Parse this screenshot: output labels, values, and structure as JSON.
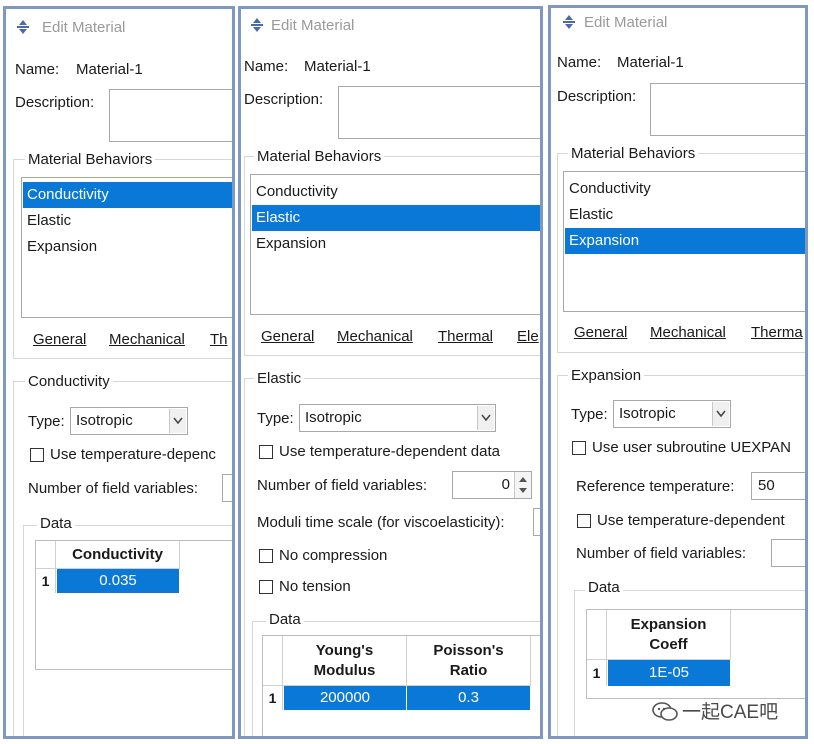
{
  "panels": [
    {
      "window_title": "Edit Material",
      "name_label": "Name:",
      "name_value": "Material-1",
      "description_label": "Description:",
      "behaviors_title": "Material Behaviors",
      "behaviors": [
        "Conductivity",
        "Elastic",
        "Expansion"
      ],
      "selected_behavior": "Conductivity",
      "tabs": [
        "General",
        "Mechanical",
        "Th"
      ],
      "section_title": "Conductivity",
      "type_label": "Type:",
      "type_value": "Isotropic",
      "checkbox_1": "Use temperature-depenc",
      "field_vars_label": "Number of field variables:",
      "data_title": "Data",
      "columns": [
        "Conductivity"
      ],
      "row_number": "1",
      "row_values": [
        "0.035"
      ]
    },
    {
      "window_title": "Edit Material",
      "name_label": "Name:",
      "name_value": "Material-1",
      "description_label": "Description:",
      "behaviors_title": "Material Behaviors",
      "behaviors": [
        "Conductivity",
        "Elastic",
        "Expansion"
      ],
      "selected_behavior": "Elastic",
      "tabs": [
        "General",
        "Mechanical",
        "Thermal",
        "Ele"
      ],
      "section_title": "Elastic",
      "type_label": "Type:",
      "type_value": "Isotropic",
      "checkbox_1": "Use temperature-dependent data",
      "field_vars_label": "Number of field variables:",
      "field_vars_value": "0",
      "moduli_label": "Moduli time scale (for viscoelasticity):",
      "checkbox_2": "No compression",
      "checkbox_3": "No tension",
      "data_title": "Data",
      "columns": [
        "Young's Modulus",
        "Poisson's Ratio"
      ],
      "row_number": "1",
      "row_values": [
        "200000",
        "0.3"
      ]
    },
    {
      "window_title": "Edit Material",
      "name_label": "Name:",
      "name_value": "Material-1",
      "description_label": "Description:",
      "behaviors_title": "Material Behaviors",
      "behaviors": [
        "Conductivity",
        "Elastic",
        "Expansion"
      ],
      "selected_behavior": "Expansion",
      "tabs": [
        "General",
        "Mechanical",
        "Therma"
      ],
      "section_title": "Expansion",
      "type_label": "Type:",
      "type_value": "Isotropic",
      "checkbox_1": "Use user subroutine UEXPAN",
      "ref_temp_label": "Reference temperature:",
      "ref_temp_value": "50",
      "checkbox_2": "Use temperature-dependent",
      "field_vars_label": "Number of field variables:",
      "data_title": "Data",
      "columns": [
        "Expansion Coeff"
      ],
      "row_number": "1",
      "row_values": [
        "1E-05"
      ]
    }
  ],
  "watermark": "一起CAE吧",
  "colors": {
    "selection": "#0a78d7",
    "panel_border": "#7f98c2"
  }
}
